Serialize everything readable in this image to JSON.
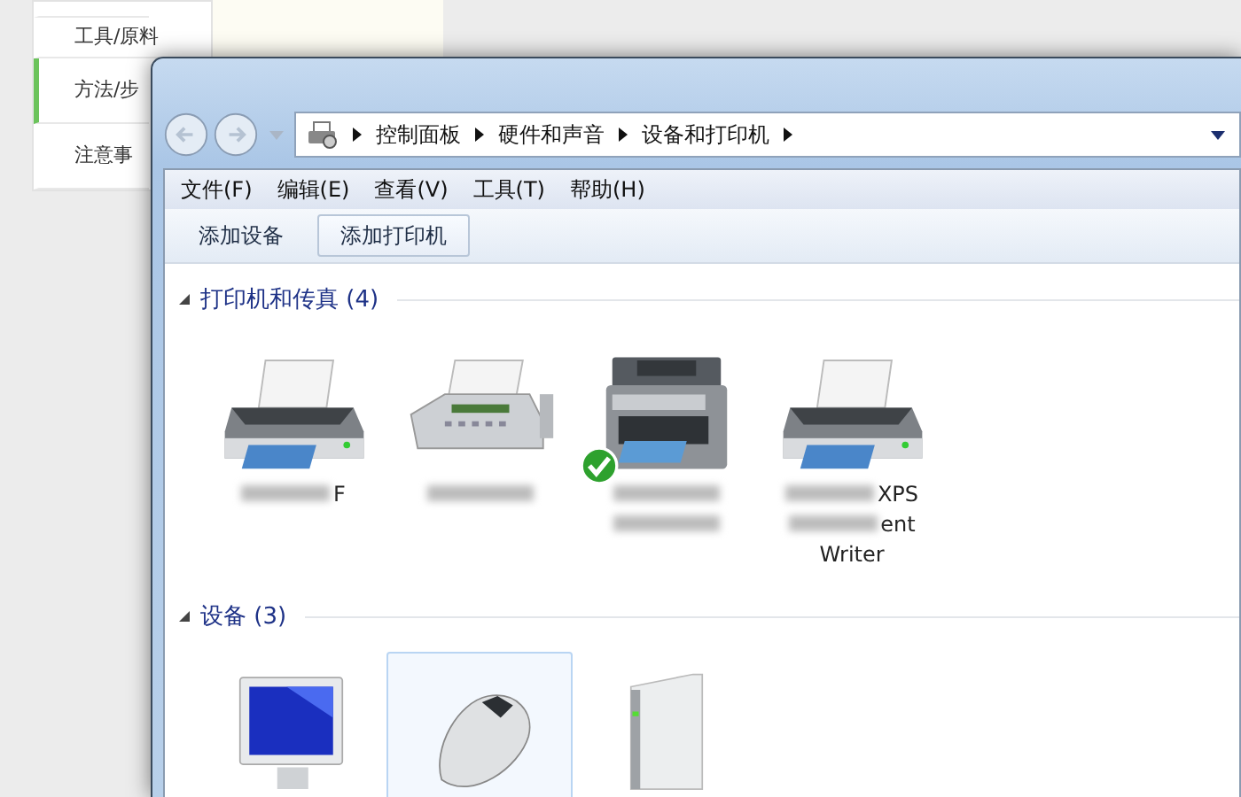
{
  "background_page": {
    "sidebar_items": [
      {
        "label": "工具/原料",
        "selected": false
      },
      {
        "label": "方法/步",
        "selected": true
      },
      {
        "label": "注意事",
        "selected": false
      }
    ]
  },
  "window": {
    "address_path": [
      "控制面板",
      "硬件和声音",
      "设备和打印机"
    ],
    "menu": [
      "文件(F)",
      "编辑(E)",
      "查看(V)",
      "工具(T)",
      "帮助(H)"
    ],
    "toolbar": [
      {
        "label": "添加设备",
        "selected": false
      },
      {
        "label": "添加打印机",
        "selected": true
      }
    ],
    "groups": [
      {
        "title": "打印机和传真 (4)",
        "expanded": true,
        "items": [
          {
            "kind": "printer",
            "default": false,
            "selected": false,
            "label_lines": [
              {
                "blurred_before": true,
                "text": "F"
              }
            ]
          },
          {
            "kind": "fax",
            "default": false,
            "selected": false,
            "label_lines": [
              {
                "blurred_before": true
              }
            ]
          },
          {
            "kind": "multifunction",
            "default": true,
            "selected": false,
            "label_lines": [
              {
                "blurred_before": true
              },
              {
                "blurred_before": true
              }
            ]
          },
          {
            "kind": "printer",
            "default": false,
            "selected": false,
            "label_lines": [
              {
                "blurred_before": true,
                "text": "XPS"
              },
              {
                "blurred_before": true,
                "text": "ent"
              },
              {
                "blurred_before": false,
                "text": "Writer"
              }
            ]
          }
        ]
      },
      {
        "title": "设备 (3)",
        "expanded": true,
        "items": [
          {
            "kind": "monitor",
            "default": false,
            "selected": false
          },
          {
            "kind": "mouse",
            "default": false,
            "selected": true
          },
          {
            "kind": "tower",
            "default": false,
            "selected": false
          }
        ]
      }
    ]
  }
}
